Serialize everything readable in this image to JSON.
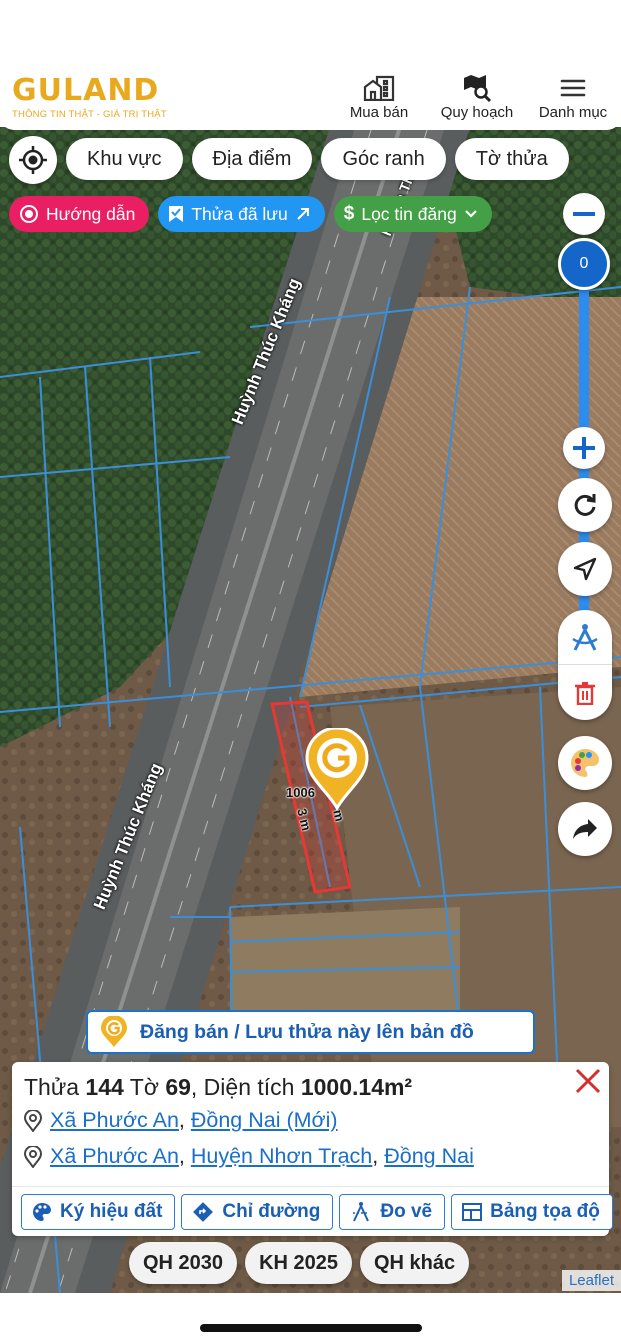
{
  "header": {
    "logo_text": "GULAND",
    "logo_tagline": "THÔNG TIN THẬT - GIÁ TRỊ THẬT",
    "nav": [
      {
        "label": "Mua bán",
        "icon": "building-icon"
      },
      {
        "label": "Quy hoạch",
        "icon": "map-search-icon"
      },
      {
        "label": "Danh mục",
        "icon": "menu-icon"
      }
    ]
  },
  "filters": {
    "chips": [
      "Khu vực",
      "Địa điểm",
      "Góc ranh",
      "Tờ thửa"
    ],
    "pills": [
      {
        "label": "Hướng dẫn",
        "color": "#e91e63",
        "icon": "target-icon"
      },
      {
        "label": "Thửa đã lưu",
        "color": "#2196f3",
        "icon": "bookmark-icon"
      },
      {
        "label": "Lọc tin đăng",
        "color": "#43a047",
        "icon": "dollar-icon"
      }
    ]
  },
  "map": {
    "zoom_value": "0",
    "road_name": "Huỳnh Thúc Kháng",
    "road_name_short": "Huỳnh Th",
    "parcel_dim_a": "1006",
    "parcel_dim_b": "3 m",
    "parcel_dim_c": "m",
    "parcel_color": "#e53935",
    "attribution": "Leaflet"
  },
  "banner": {
    "text": "Đăng bán / Lưu thửa này lên bản đồ"
  },
  "parcel_info": {
    "thua_label": "Thửa",
    "thua_number": "144",
    "to_label": "Tờ",
    "to_number": "69",
    "area_label": ", Diện tích",
    "area_value": "1000.14m²",
    "address_new": {
      "commune": "Xã Phước An",
      "province": "Đồng Nai (Mới)"
    },
    "address_old": {
      "commune": "Xã Phước An",
      "district": "Huyện Nhơn Trạch",
      "province": "Đồng Nai"
    },
    "actions": [
      "Ký hiệu đất",
      "Chỉ đường",
      "Đo vẽ",
      "Bảng tọa độ"
    ]
  },
  "layers": [
    "QH 2030",
    "KH 2025",
    "QH khác"
  ]
}
